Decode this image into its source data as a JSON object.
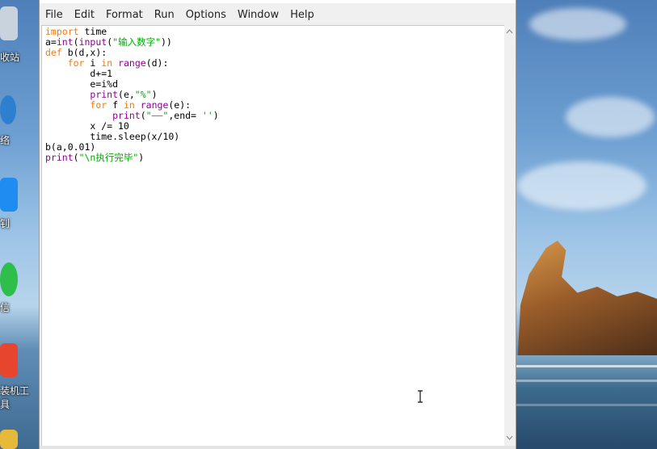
{
  "window": {
    "menu": [
      "File",
      "Edit",
      "Format",
      "Run",
      "Options",
      "Window",
      "Help"
    ]
  },
  "editor": {
    "lines": [
      [
        {
          "t": "import",
          "c": "kw"
        },
        {
          "t": " time",
          "c": ""
        }
      ],
      [
        {
          "t": "a=",
          "c": ""
        },
        {
          "t": "int",
          "c": "bi"
        },
        {
          "t": "(",
          "c": ""
        },
        {
          "t": "input",
          "c": "bi"
        },
        {
          "t": "(",
          "c": ""
        },
        {
          "t": "\"输入数字\"",
          "c": "str"
        },
        {
          "t": "))",
          "c": ""
        }
      ],
      [
        {
          "t": "def",
          "c": "kw"
        },
        {
          "t": " b(d,x):",
          "c": ""
        }
      ],
      [
        {
          "t": "    ",
          "c": ""
        },
        {
          "t": "for",
          "c": "kw"
        },
        {
          "t": " i ",
          "c": ""
        },
        {
          "t": "in",
          "c": "kw"
        },
        {
          "t": " ",
          "c": ""
        },
        {
          "t": "range",
          "c": "bi"
        },
        {
          "t": "(d):",
          "c": ""
        }
      ],
      [
        {
          "t": "        d+=1",
          "c": ""
        }
      ],
      [
        {
          "t": "        e=i%d",
          "c": ""
        }
      ],
      [
        {
          "t": "        ",
          "c": ""
        },
        {
          "t": "print",
          "c": "bi"
        },
        {
          "t": "(e,",
          "c": ""
        },
        {
          "t": "\"%\"",
          "c": "str"
        },
        {
          "t": ")",
          "c": ""
        }
      ],
      [
        {
          "t": "        ",
          "c": ""
        },
        {
          "t": "for",
          "c": "kw"
        },
        {
          "t": " f ",
          "c": ""
        },
        {
          "t": "in",
          "c": "kw"
        },
        {
          "t": " ",
          "c": ""
        },
        {
          "t": "range",
          "c": "bi"
        },
        {
          "t": "(e):",
          "c": ""
        }
      ],
      [
        {
          "t": "            ",
          "c": ""
        },
        {
          "t": "print",
          "c": "bi"
        },
        {
          "t": "(",
          "c": ""
        },
        {
          "t": "\"——\"",
          "c": "str"
        },
        {
          "t": ",end= ",
          "c": ""
        },
        {
          "t": "''",
          "c": "str"
        },
        {
          "t": ")",
          "c": ""
        }
      ],
      [
        {
          "t": "        x /= 10",
          "c": ""
        }
      ],
      [
        {
          "t": "        time.sleep(x/10)",
          "c": ""
        }
      ],
      [
        {
          "t": "b(a,0.01)",
          "c": ""
        }
      ],
      [
        {
          "t": "print",
          "c": "bi"
        },
        {
          "t": "(",
          "c": ""
        },
        {
          "t": "\"\\n执行完毕\"",
          "c": "str"
        },
        {
          "t": ")",
          "c": ""
        }
      ]
    ]
  },
  "desktop": {
    "labels": [
      "收站",
      "络",
      "钊",
      "信",
      "装机工",
      "具"
    ]
  },
  "colors": {
    "keyword": "#ff7700",
    "builtin": "#900090",
    "string": "#00aa00"
  },
  "icons": [
    "up-arrow-icon",
    "down-arrow-icon",
    "text-ibeam-cursor-icon"
  ]
}
